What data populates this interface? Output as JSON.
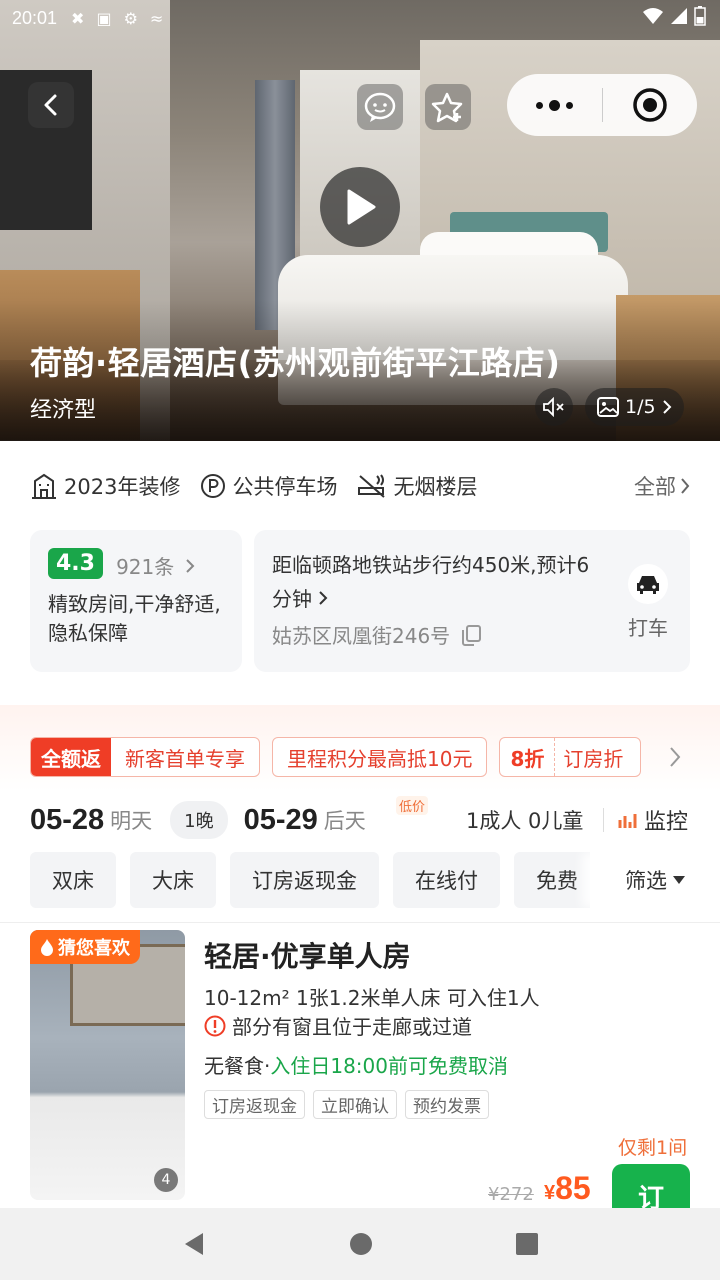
{
  "status_bar": {
    "time": "20:01"
  },
  "hero": {
    "hotel_name": "荷韵·轻居酒店(苏州观前街平江路店)",
    "hotel_type": "经济型",
    "photo_count": "1/5"
  },
  "facilities": {
    "items": [
      {
        "icon": "building-icon",
        "label": "2023年装修"
      },
      {
        "icon": "parking-icon",
        "label": "公共停车场"
      },
      {
        "icon": "no-smoking-icon",
        "label": "无烟楼层"
      }
    ],
    "all_label": "全部"
  },
  "rating": {
    "score": "4.3",
    "reviews": "921条",
    "summary": "精致房间,干净舒适,隐私保障"
  },
  "location": {
    "distance": "距临顿路地铁站步行约450米,预计6分钟",
    "address": "姑苏区凤凰街246号",
    "taxi_label": "打车"
  },
  "promos": {
    "full_refund_tag": "全额返",
    "new_customer": "新客首单专享",
    "mileage": "里程积分最高抵10元",
    "discount_tag": "8折",
    "discount_text": "订房折"
  },
  "dates": {
    "checkin": "05-28",
    "checkin_day": "明天",
    "nights": "1晚",
    "checkout": "05-29",
    "checkout_day": "后天",
    "low_price": "低价",
    "guests": "1成人 0儿童",
    "monitor": "监控"
  },
  "filters": {
    "chips": [
      "双床",
      "大床",
      "订房返现金",
      "在线付",
      "免费"
    ],
    "filter_label": "筛选"
  },
  "room": {
    "guess_tag": "猜您喜欢",
    "image_count": "4",
    "title": "轻居·优享单人房",
    "spec": "10-12m²   1张1.2米单人床   可入住1人",
    "warning": "部分有窗且位于走廊或过道",
    "meal": "无餐食·",
    "cancel": "入住日18:00前可免费取消",
    "tags": [
      "订房返现金",
      "立即确认",
      "预约发票"
    ],
    "only_left": "仅剩1间",
    "original_price": "¥272",
    "price_currency": "¥",
    "price": "85",
    "book_label": "订"
  },
  "colors": {
    "accent_green": "#1aa64a",
    "price_orange": "#ff5a1f",
    "promo_red": "#ef3d26"
  }
}
